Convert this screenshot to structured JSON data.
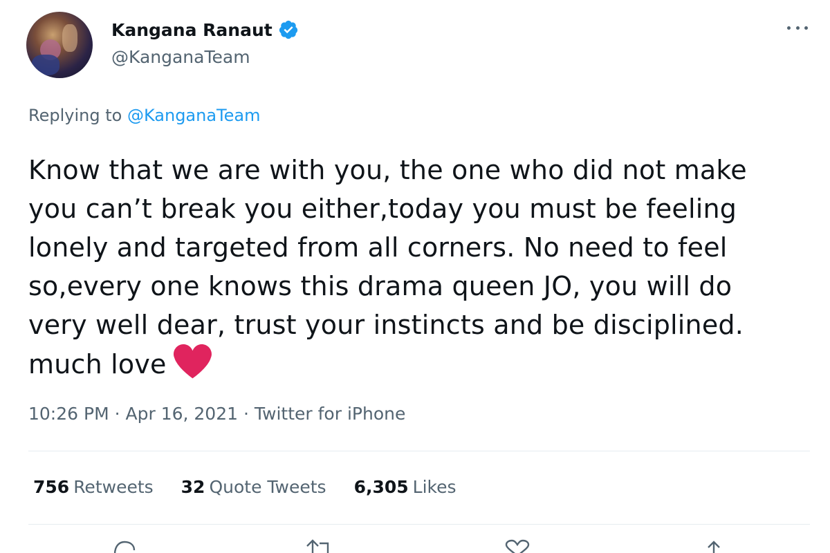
{
  "author": {
    "display_name": "Kangana Ranaut",
    "handle": "@KanganaTeam",
    "verified": true
  },
  "reply_context": {
    "prefix": "Replying to",
    "handle": "@KanganaTeam"
  },
  "tweet": {
    "lines": [
      "Know that we are with you, the one who did not make",
      "you can’t break you either,today you must be feeling",
      "lonely and targeted from all corners. No need to feel",
      "so,every one knows this drama queen JO, you will do",
      "very well dear, trust your instincts and be disciplined.",
      "much love"
    ],
    "emoji": "red-heart"
  },
  "meta": {
    "time": "10:26 PM",
    "separator": "·",
    "date": "Apr 16, 2021",
    "source": "Twitter for iPhone"
  },
  "stats": {
    "retweets": {
      "count": "756",
      "label": "Retweets"
    },
    "quote_tweets": {
      "count": "32",
      "label": "Quote Tweets"
    },
    "likes": {
      "count": "6,305",
      "label": "Likes"
    }
  },
  "icons": {
    "verified": "verified-badge-icon",
    "more": "more-options-icon",
    "reply": "reply-icon",
    "retweet": "retweet-icon",
    "like": "like-icon",
    "share": "share-icon"
  },
  "colors": {
    "accent": "#1d9bf0",
    "text": "#0f1419",
    "secondary": "#536471",
    "heart": "#e0245e"
  }
}
